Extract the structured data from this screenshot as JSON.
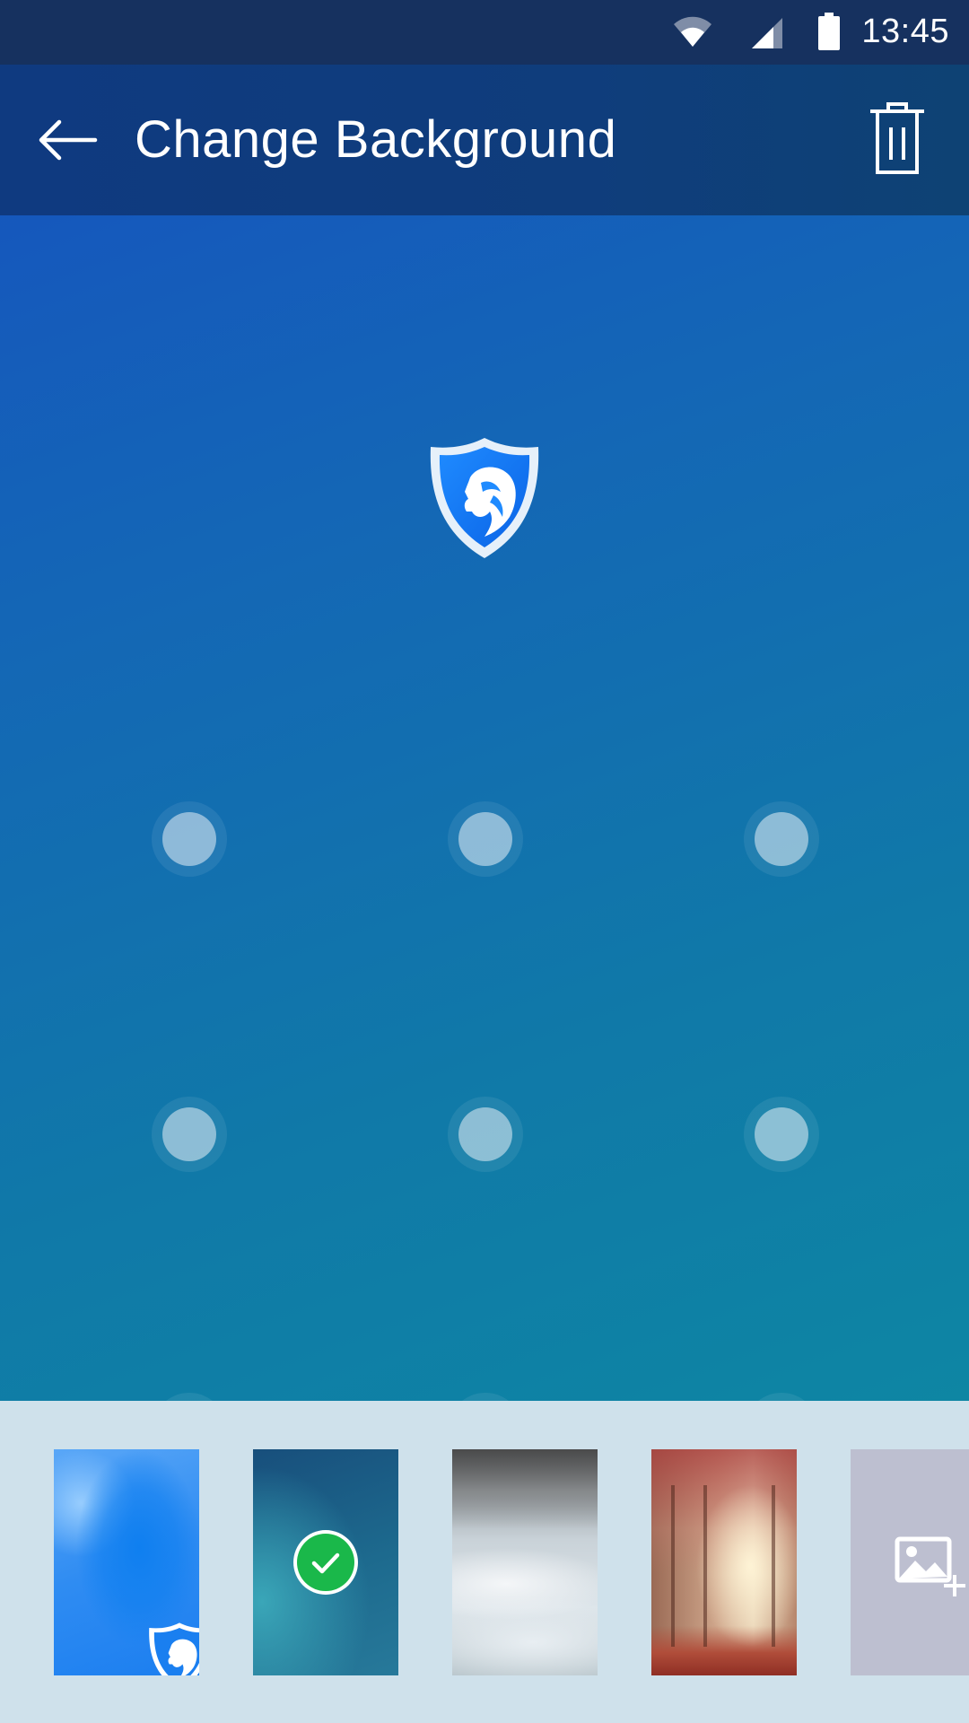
{
  "status_bar": {
    "time": "13:45",
    "icons": [
      "wifi-icon",
      "cellular-signal-icon",
      "battery-icon"
    ]
  },
  "app_bar": {
    "title": "Change Background",
    "back_icon": "arrow-left-icon",
    "delete_icon": "trash-icon"
  },
  "preview": {
    "logo_icon": "lion-shield-logo",
    "pattern_rows": 3,
    "pattern_cols": 3
  },
  "backgrounds": {
    "items": [
      {
        "name": "blue-gradient",
        "selected": false,
        "badge": "lion-shield-logo"
      },
      {
        "name": "teal-gradient",
        "selected": true,
        "badge": "check-icon"
      },
      {
        "name": "waterfall-photo",
        "selected": false
      },
      {
        "name": "autumn-forest-photo",
        "selected": false
      },
      {
        "name": "add-custom-image",
        "selected": false,
        "icon": "add-image-icon"
      }
    ]
  },
  "colors": {
    "status_bar": "#16315f",
    "app_bar": "#0f3a80",
    "tray": "#cfe1eb",
    "selected_check": "#1ab84a",
    "brand_blue": "#1a7ff0"
  }
}
